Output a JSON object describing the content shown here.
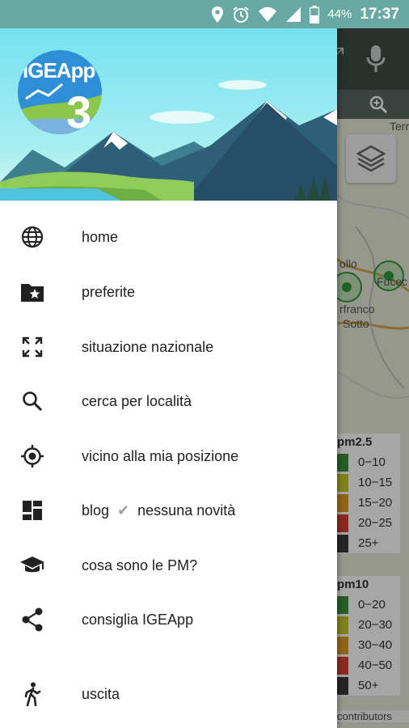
{
  "status_bar": {
    "battery": "44%",
    "time": "17:37",
    "icons": [
      "location-icon",
      "alarm-icon",
      "wifi-icon",
      "signal-icon",
      "battery-icon"
    ]
  },
  "header": {
    "logo_text": "IGEApp",
    "logo_number": "3"
  },
  "menu": {
    "items": [
      {
        "label": "home",
        "icon": "globe-icon"
      },
      {
        "label": "preferite",
        "icon": "folder-star-icon"
      },
      {
        "label": "situazione nazionale",
        "icon": "fullscreen-icon"
      },
      {
        "label": "cerca per località",
        "icon": "search-icon"
      },
      {
        "label": "vicino alla mia posizione",
        "icon": "my-location-icon"
      },
      {
        "label": "blog",
        "status": "nessuna novità",
        "icon": "dashboard-icon"
      },
      {
        "label": "cosa sono le PM?",
        "icon": "school-icon"
      },
      {
        "label": "consiglia IGEApp",
        "icon": "share-icon"
      },
      {
        "label": "uscita",
        "icon": "walk-icon"
      }
    ]
  },
  "map": {
    "labels": [
      "Terr",
      "Fucec",
      "rfranco",
      "Sotto",
      "ollo"
    ],
    "legend_pm25": {
      "title": "pm2.5",
      "rows": [
        {
          "range": "0−10",
          "color": "#3a8f3a"
        },
        {
          "range": "10−15",
          "color": "#c3c42a"
        },
        {
          "range": "15−20",
          "color": "#e09a2a"
        },
        {
          "range": "20−25",
          "color": "#d6412f"
        },
        {
          "range": "25+",
          "color": "#3a3a3a"
        }
      ]
    },
    "legend_pm10": {
      "title": "pm10",
      "rows": [
        {
          "range": "0−20",
          "color": "#3a8f3a"
        },
        {
          "range": "20−30",
          "color": "#c3c42a"
        },
        {
          "range": "30−40",
          "color": "#e09a2a"
        },
        {
          "range": "40−50",
          "color": "#d6412f"
        },
        {
          "range": "50+",
          "color": "#3a3a3a"
        }
      ]
    },
    "attribution": "contributors"
  }
}
